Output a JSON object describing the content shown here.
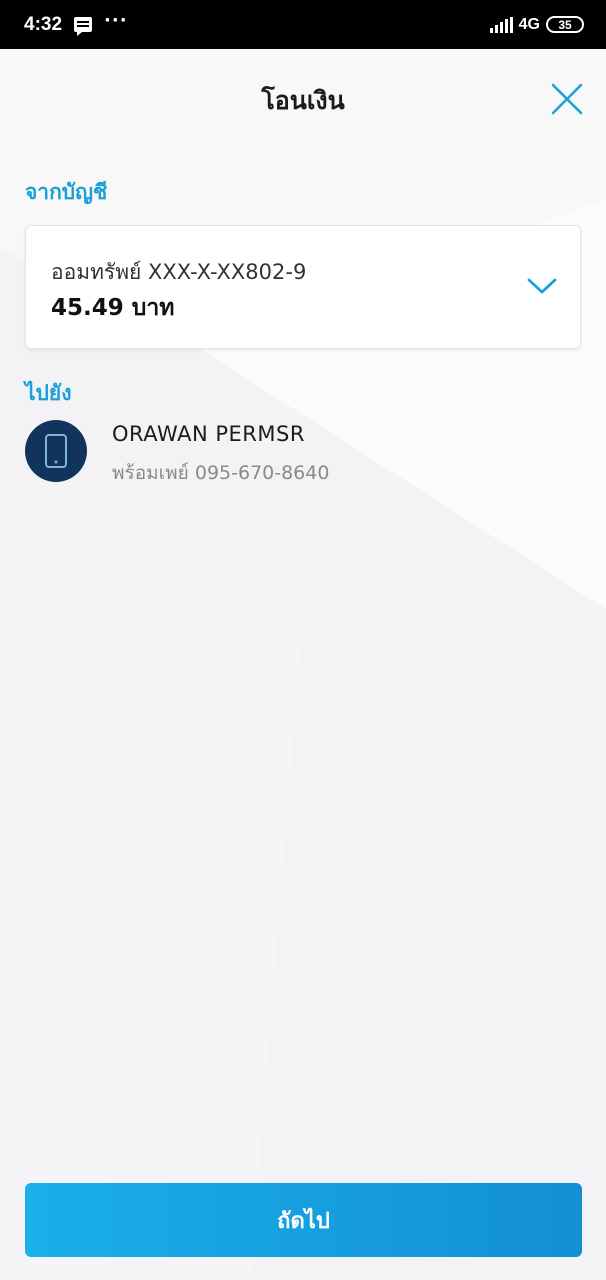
{
  "status_bar": {
    "time": "4:32",
    "more": "···",
    "network": "4G",
    "battery": "35",
    "icons": [
      "message-icon",
      "signal-icon",
      "battery-icon"
    ]
  },
  "header": {
    "title": "โอนเงิน",
    "close_icon": "close-icon"
  },
  "from": {
    "label": "จากบัญชี",
    "account_name": "ออมทรัพย์ XXX-X-XX802-9",
    "balance": "45.49 บาท"
  },
  "to": {
    "label": "ไปยัง",
    "recipient_name": "ORAWAN PERMSR",
    "recipient_detail": "พร้อมเพย์ 095-670-8640",
    "avatar_icon": "mobile-phone-icon"
  },
  "footer": {
    "next_label": "ถัดไป"
  },
  "colors": {
    "accent": "#1aa0d8",
    "button_start": "#1ab0ea",
    "button_end": "#138fd4",
    "avatar_bg": "#10345c"
  }
}
